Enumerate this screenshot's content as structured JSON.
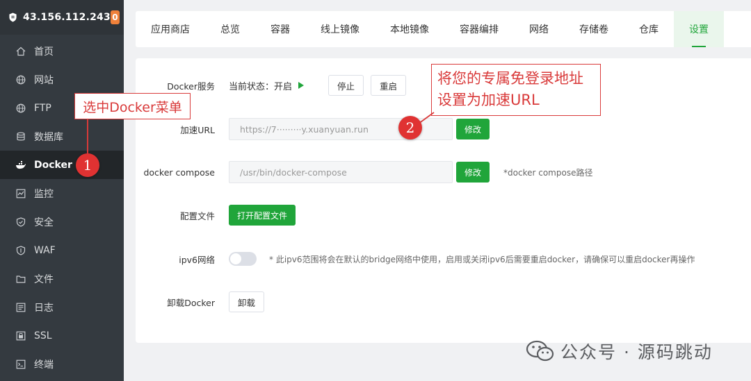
{
  "sidebar": {
    "ip": "43.156.112.243",
    "badge": "0",
    "items": [
      {
        "label": "首页",
        "icon": "home-icon"
      },
      {
        "label": "网站",
        "icon": "globe-icon"
      },
      {
        "label": "FTP",
        "icon": "globe-icon"
      },
      {
        "label": "数据库",
        "icon": "database-icon"
      },
      {
        "label": "Docker",
        "icon": "docker-icon",
        "active": true
      },
      {
        "label": "监控",
        "icon": "monitor-icon"
      },
      {
        "label": "安全",
        "icon": "shield-icon"
      },
      {
        "label": "WAF",
        "icon": "waf-icon"
      },
      {
        "label": "文件",
        "icon": "folder-icon"
      },
      {
        "label": "日志",
        "icon": "log-icon"
      },
      {
        "label": "SSL",
        "icon": "ssl-icon"
      },
      {
        "label": "终端",
        "icon": "terminal-icon"
      }
    ]
  },
  "tabs": [
    "应用商店",
    "总览",
    "容器",
    "线上镜像",
    "本地镜像",
    "容器编排",
    "网络",
    "存储卷",
    "仓库",
    "设置"
  ],
  "active_tab": "设置",
  "settings": {
    "service_label": "Docker服务",
    "status_text": "当前状态：开启",
    "stop_button": "停止",
    "restart_button": "重启",
    "mirror_label": "加速URL",
    "mirror_value": "https://7·········y.xuanyuan.run",
    "mirror_edit": "修改",
    "compose_label": "docker compose",
    "compose_value": "/usr/bin/docker-compose",
    "compose_edit": "修改",
    "compose_hint": "*docker compose路径",
    "config_label": "配置文件",
    "config_button": "打开配置文件",
    "ipv6_label": "ipv6网络",
    "ipv6_hint": "* 此ipv6范围将会在默认的bridge网络中使用，启用或关闭ipv6后需要重启docker，请确保可以重启docker再操作",
    "uninstall_label": "卸载Docker",
    "uninstall_button": "卸载"
  },
  "annotations": {
    "note1": "选中Docker菜单",
    "note2_line1": "将您的专属免登录地址",
    "note2_line2": "设置为加速URL",
    "step1": "1",
    "step2": "2"
  },
  "watermark": "公众号 · 源码跳动",
  "colors": {
    "accent": "#20a53a",
    "sidebar": "#343a40",
    "annotation": "#d93a3a"
  }
}
